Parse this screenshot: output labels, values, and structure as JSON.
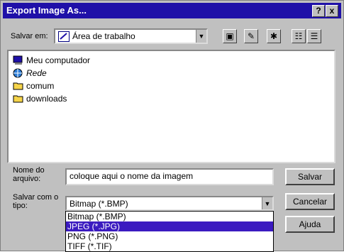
{
  "window": {
    "title": "Export Image As..."
  },
  "titlebar": {
    "help": "?",
    "close": "x"
  },
  "location": {
    "label": "Salvar em:",
    "value": "Área de trabalho"
  },
  "files": [
    {
      "name": "Meu computador",
      "icon": "computer-icon"
    },
    {
      "name": "Rede",
      "icon": "network-icon"
    },
    {
      "name": "comum",
      "icon": "folder-icon"
    },
    {
      "name": "downloads",
      "icon": "folder-icon"
    }
  ],
  "filename": {
    "label": "Nome do arquivo:",
    "value": "coloque aqui o nome da imagem"
  },
  "filetype": {
    "label": "Salvar com o tipo:",
    "value": "Bitmap (*.BMP)",
    "options": [
      "Bitmap (*.BMP)",
      "JPEG (*.JPG)",
      "PNG (*.PNG)",
      "TIFF (*.TIF)"
    ],
    "selected_option": "JPEG (*.JPG)"
  },
  "buttons": {
    "save": "Salvar",
    "cancel": "Cancelar",
    "help": "Ajuda"
  },
  "colors": {
    "titlebar": "#1f10a8",
    "selection": "#3b1bc0",
    "face": "#c0c0c0"
  }
}
